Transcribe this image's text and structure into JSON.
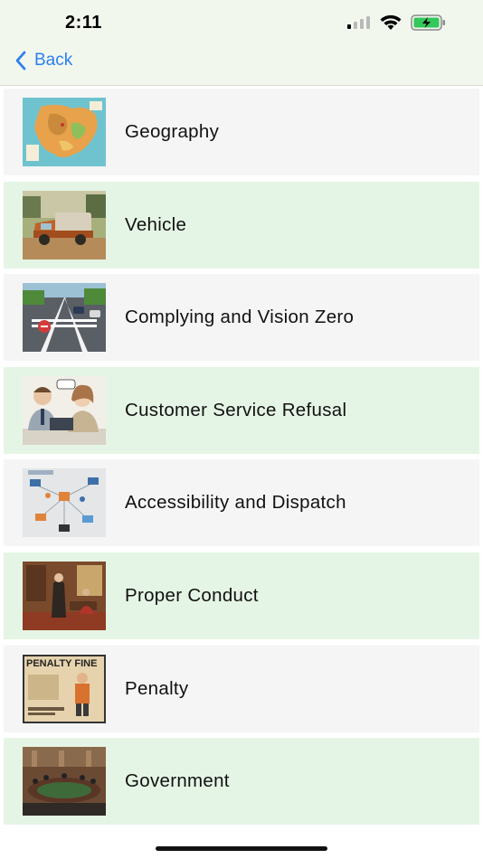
{
  "status_bar": {
    "time": "2:11",
    "icons": [
      "cellular-signal-icon",
      "wifi-icon",
      "battery-charging-icon"
    ],
    "battery_color": "#34c759"
  },
  "nav": {
    "back_label": "Back",
    "accent": "#2a7ff0"
  },
  "topics": [
    {
      "label": "Geography",
      "image": "map-of-europe-illustration"
    },
    {
      "label": "Vehicle",
      "image": "vintage-truck-illustration"
    },
    {
      "label": "Complying and Vision Zero",
      "image": "street-traffic-illustration"
    },
    {
      "label": "Customer Service Refusal",
      "image": "call-center-agents-illustration"
    },
    {
      "label": "Accessibility and Dispatch",
      "image": "dispatch-network-illustration"
    },
    {
      "label": "Proper Conduct",
      "image": "formal-room-illustration"
    },
    {
      "label": "Penalty",
      "image": "penalty-fine-poster-illustration",
      "image_text": "PENALTY FINE"
    },
    {
      "label": "Government",
      "image": "government-chamber-illustration"
    }
  ],
  "colors": {
    "row_odd": "#f5f5f5",
    "row_even": "#e5f5e5"
  }
}
